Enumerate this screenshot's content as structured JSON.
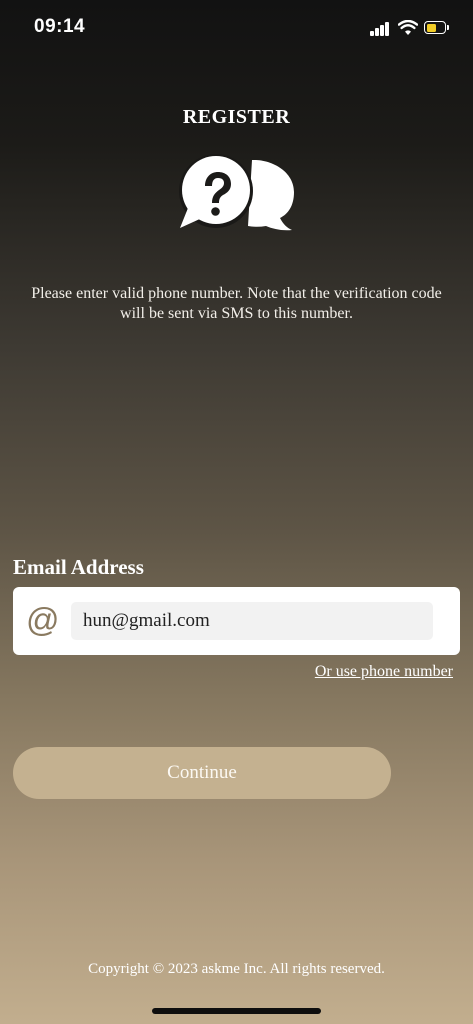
{
  "status_bar": {
    "time": "09:14",
    "icons": [
      "signal-icon",
      "wifi-icon",
      "battery-icon"
    ],
    "battery_level": 0.55,
    "battery_color": "#f2cd27"
  },
  "header": {
    "title": "REGISTER",
    "logo_icon": "chat-question-icon"
  },
  "instruction": "Please enter valid phone number. Note that the verification code will be sent via SMS to this number.",
  "form": {
    "email_label": "Email Address",
    "email_icon": "at-icon",
    "email_value": "hun@gmail.com",
    "alt_link": "Or use phone number"
  },
  "continue_button": {
    "label": "Continue",
    "color": "#c4b190"
  },
  "footer": {
    "copyright": "Copyright © 2023 askme Inc. All rights reserved."
  }
}
